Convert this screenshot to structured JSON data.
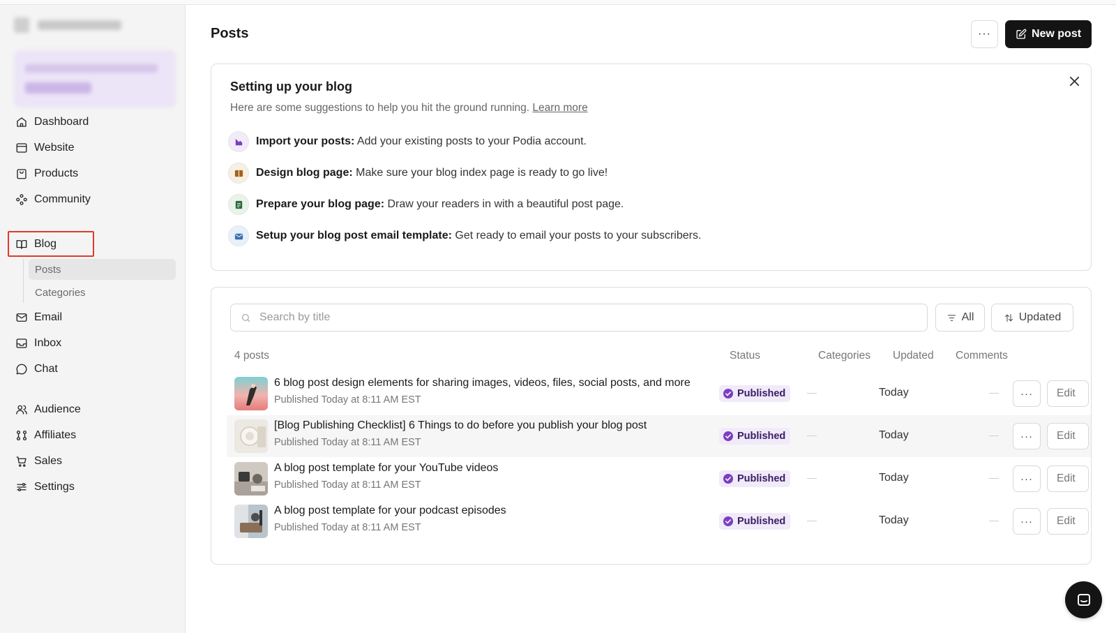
{
  "page": {
    "title": "Posts"
  },
  "header": {
    "more_label": "···",
    "new_post_label": "New post"
  },
  "sidebar": {
    "items": [
      {
        "label": "Dashboard",
        "icon": "home-icon"
      },
      {
        "label": "Website",
        "icon": "browser-icon"
      },
      {
        "label": "Products",
        "icon": "bag-icon"
      },
      {
        "label": "Community",
        "icon": "community-icon"
      },
      {
        "label": "Blog",
        "icon": "book-icon"
      },
      {
        "label": "Email",
        "icon": "mail-icon"
      },
      {
        "label": "Inbox",
        "icon": "inbox-icon"
      },
      {
        "label": "Chat",
        "icon": "chat-icon"
      },
      {
        "label": "Audience",
        "icon": "users-icon"
      },
      {
        "label": "Affiliates",
        "icon": "affiliates-icon"
      },
      {
        "label": "Sales",
        "icon": "cart-icon"
      },
      {
        "label": "Settings",
        "icon": "sliders-icon"
      }
    ],
    "blog_sub": [
      {
        "label": "Posts"
      },
      {
        "label": "Categories"
      }
    ]
  },
  "setup": {
    "title": "Setting up your blog",
    "subtitle": "Here are some suggestions to help you hit the ground running.",
    "learn_more": "Learn more",
    "tips": [
      {
        "bold": "Import your posts:",
        "text": "Add your existing posts to your Podia account.",
        "color": "#7a3fc0",
        "bg": "#f2ebfa"
      },
      {
        "bold": "Design blog page:",
        "text": "Make sure your blog index page is ready to go live!",
        "color": "#a3611f",
        "bg": "#f8efe3"
      },
      {
        "bold": "Prepare your blog page:",
        "text": "Draw your readers in with a beautiful post page.",
        "color": "#2d6b3f",
        "bg": "#e8f3ea"
      },
      {
        "bold": "Setup your blog post email template:",
        "text": "Get ready to email your posts to your subscribers.",
        "color": "#3b6fb0",
        "bg": "#e8f0fa"
      }
    ]
  },
  "list": {
    "search_placeholder": "Search by title",
    "filter_label": "All",
    "sort_label": "Updated",
    "count": "4 posts",
    "columns": {
      "status": "Status",
      "categories": "Categories",
      "updated": "Updated",
      "comments": "Comments"
    },
    "rows": [
      {
        "title": "6 blog post design elements for sharing images, videos, files, social posts, and more",
        "meta": "Published Today at 8:11 AM EST",
        "status": "Published",
        "updated": "Today",
        "edit": "Edit"
      },
      {
        "title": "[Blog Publishing Checklist] 6 Things to do before you publish your blog post",
        "meta": "Published Today at 8:11 AM EST",
        "status": "Published",
        "updated": "Today",
        "edit": "Edit"
      },
      {
        "title": "A blog post template for your YouTube videos",
        "meta": "Published Today at 8:11 AM EST",
        "status": "Published",
        "updated": "Today",
        "edit": "Edit"
      },
      {
        "title": "A blog post template for your podcast episodes",
        "meta": "Published Today at 8:11 AM EST",
        "status": "Published",
        "updated": "Today",
        "edit": "Edit"
      }
    ],
    "row_more_label": "···"
  },
  "colors": {
    "accent": "#141414",
    "badge_bg": "#f1eaf8",
    "badge_check": "#7a3fc0",
    "highlight": "#e03a2c"
  }
}
